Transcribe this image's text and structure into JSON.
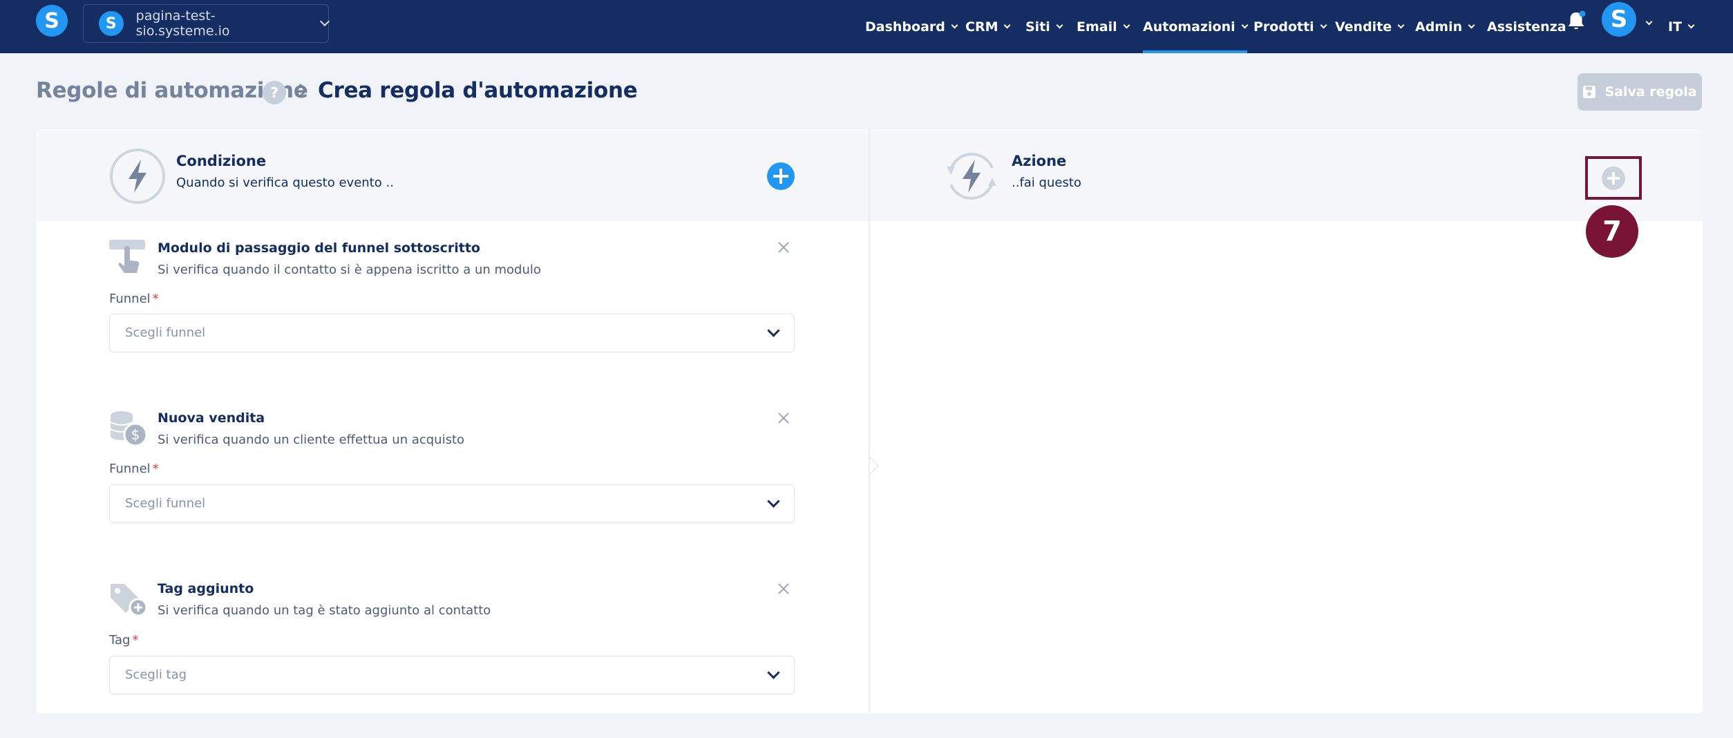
{
  "topbar": {
    "logo": "S",
    "site": {
      "logo": "S",
      "name": "pagina-test-sio.systeme.io"
    },
    "nav": [
      {
        "label": "Dashboard",
        "has_menu": true
      },
      {
        "label": "CRM",
        "has_menu": true
      },
      {
        "label": "Siti",
        "has_menu": true
      },
      {
        "label": "Email",
        "has_menu": true
      },
      {
        "label": "Automazioni",
        "has_menu": true,
        "active": true
      },
      {
        "label": "Prodotti",
        "has_menu": true
      },
      {
        "label": "Vendite",
        "has_menu": true
      },
      {
        "label": "Admin",
        "has_menu": true
      },
      {
        "label": "Assistenza",
        "has_menu": false
      }
    ],
    "avatar": "S",
    "language": "IT"
  },
  "header": {
    "breadcrumb_parent": "Regole di automazione",
    "help": "?",
    "breadcrumb_current": "Crea regola d'automazione",
    "save_label": "Salva regola"
  },
  "condition": {
    "title": "Condizione",
    "subtitle": "Quando si verifica questo evento .."
  },
  "action": {
    "title": "Azione",
    "subtitle": "..fai questo"
  },
  "step_badge": "7",
  "cards": [
    {
      "title": "Modulo di passaggio del funnel sottoscritto",
      "description": "Si verifica quando il contatto si è appena iscritto a un modulo",
      "field_label": "Funnel",
      "required": "*",
      "placeholder": "Scegli funnel"
    },
    {
      "title": "Nuova vendita",
      "description": "Si verifica quando un cliente effettua un acquisto",
      "field_label": "Funnel",
      "required": "*",
      "placeholder": "Scegli funnel"
    },
    {
      "title": "Tag aggiunto",
      "description": "Si verifica quando un tag è stato aggiunto al contatto",
      "field_label": "Tag",
      "required": "*",
      "placeholder": "Scegli tag"
    }
  ],
  "colors": {
    "nav_bg": "#142d63",
    "accent": "#2196f3",
    "highlight": "#7a1436",
    "page_bg": "#f0f3f8"
  }
}
